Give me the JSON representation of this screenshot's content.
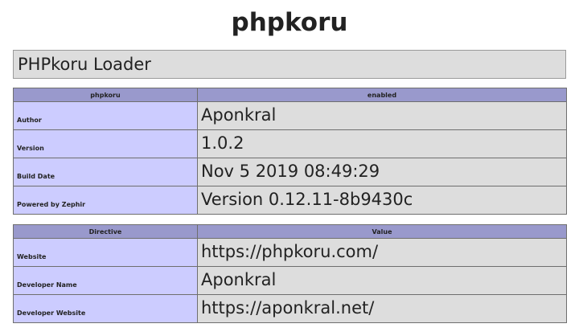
{
  "page": {
    "title": "phpkoru"
  },
  "module": {
    "header": "PHPkoru Loader"
  },
  "info_table": {
    "headers": [
      "phpkoru",
      "enabled"
    ],
    "rows": [
      {
        "key": "Author",
        "value": "Aponkral"
      },
      {
        "key": "Version",
        "value": "1.0.2"
      },
      {
        "key": "Build Date",
        "value": "Nov 5 2019 08:49:29"
      },
      {
        "key": "Powered by Zephir",
        "value": "Version 0.12.11-8b9430c"
      }
    ]
  },
  "directive_table": {
    "headers": [
      "Directive",
      "Value"
    ],
    "rows": [
      {
        "key": "Website",
        "value": "https://phpkoru.com/"
      },
      {
        "key": "Developer Name",
        "value": "Aponkral"
      },
      {
        "key": "Developer Website",
        "value": "https://aponkral.net/"
      }
    ]
  },
  "colors": {
    "header_row": "#9999cc",
    "key_cell": "#ccccff",
    "value_cell": "#dddddd",
    "text": "#222222"
  }
}
